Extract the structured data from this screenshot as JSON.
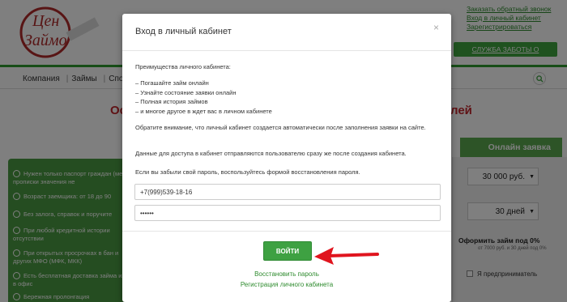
{
  "header": {
    "links": [
      "Заказать обратный звонок",
      "Вход в личный кабинет",
      "Зарегистрироваться"
    ],
    "care_button": "СЛУЖБА ЗАБОТЫ О КЛИЕНТАХ",
    "nav": [
      "Компания",
      "Займы",
      "Спо"
    ]
  },
  "main": {
    "headline_left": "Остав",
    "headline_right": "лей",
    "benefits": [
      "Нужен только паспорт граждан (место прописки значения не",
      "Возраст заемщика: от 18 до 90",
      "Без залога, справок и поручите",
      "При любой кредитной истории отсутствии",
      "При открытых просрочках в бан и других МФО (МФК, МКК)",
      "Есть бесплатная доставка займа или в офис",
      "Бережная пролонгация"
    ],
    "online_tab": "Онлайн заявка",
    "amount": "30 000 руб.",
    "term": "30 дней",
    "form_text": "Оформить займ под 0%",
    "form_subtext": "от 7000 руб. и 30 дней под 0%",
    "entrepreneur": "Я предприниматель"
  },
  "modal": {
    "title": "Вход в личный кабинет",
    "close": "×",
    "intro": "Преимущества личного кабинета:",
    "features": [
      "– Погашайте займ онлайн",
      "– Узнайте состояние заявки онлайн",
      "– Полная история займов",
      "– и многое другое в ждет вас в личном кабинете"
    ],
    "note": "Обратите внимание, что личный кабинет создается автоматически после заполнения заявки на сайте.",
    "access_note": "Данные для доступа в кабинет отправляются пользователю сразу же после создания кабинета.",
    "forgot_note": "Если вы забыли свой пароль, воспользуйтесь формой восстановления пароля.",
    "phone_value": "+7(999)539-18-16",
    "password_value": "••••••",
    "login_button": "ВОЙТИ",
    "restore_link": "Восстановить пароль",
    "register_link": "Регистрация личного кабинета"
  },
  "colors": {
    "accent_green": "#3ea142",
    "headline_red": "#c0262c",
    "arrow_red": "#e0141e"
  }
}
